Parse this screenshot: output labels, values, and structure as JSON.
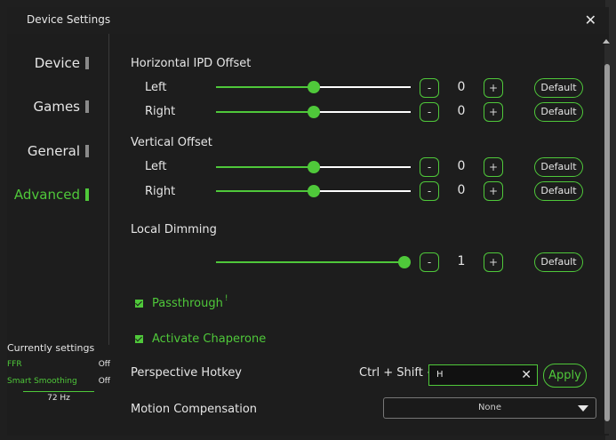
{
  "window": {
    "title": "Device Settings"
  },
  "sidebar": {
    "items": [
      {
        "label": "Device"
      },
      {
        "label": "Games"
      },
      {
        "label": "General"
      },
      {
        "label": "Advanced",
        "active": true
      }
    ]
  },
  "status": {
    "title": "Currently settings",
    "rows": [
      {
        "key": "FFR",
        "value": "Off"
      },
      {
        "key": "Smart Smoothing",
        "value": "Off"
      }
    ],
    "refresh": "72 Hz"
  },
  "sections": {
    "hipd": {
      "title": "Horizontal IPD Offset",
      "left": {
        "label": "Left",
        "value": "0",
        "level": 0.5
      },
      "right": {
        "label": "Right",
        "value": "0",
        "level": 0.5
      }
    },
    "vert": {
      "title": "Vertical Offset",
      "left": {
        "label": "Left",
        "value": "0",
        "level": 0.5
      },
      "right": {
        "label": "Right",
        "value": "0",
        "level": 0.5
      }
    },
    "dimming": {
      "title": "Local Dimming",
      "value": "1",
      "level": 1.0
    }
  },
  "controls": {
    "minus": "-",
    "plus": "+",
    "default": "Default"
  },
  "passthrough": {
    "label": "Passthrough",
    "info": "!"
  },
  "chaperone": {
    "label": "Activate Chaperone"
  },
  "hotkey": {
    "label": "Perspective Hotkey",
    "prefix": "Ctrl + Shift +",
    "value": "H",
    "clear": "✕",
    "apply": "Apply"
  },
  "motion": {
    "label": "Motion Compensation",
    "selected": "None"
  },
  "colors": {
    "accent": "#4fc83a",
    "background": "#1d1d1d",
    "text": "#e6e6e6"
  }
}
